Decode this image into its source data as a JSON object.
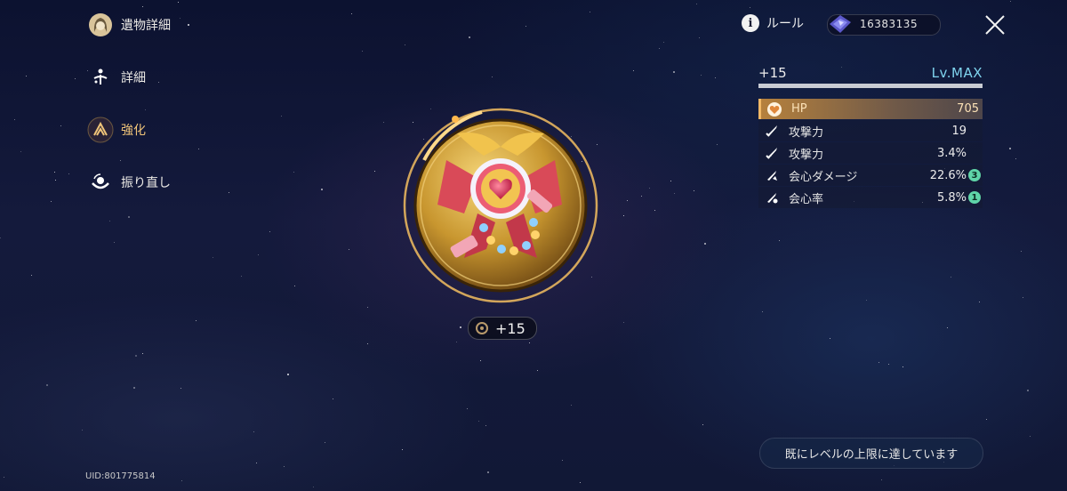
{
  "nav": {
    "items": [
      {
        "label": "遺物詳細",
        "icon": "character-portrait-icon",
        "active": false
      },
      {
        "label": "詳細",
        "icon": "details-icon",
        "active": false
      },
      {
        "label": "強化",
        "icon": "enhance-icon",
        "active": true
      },
      {
        "label": "振り直し",
        "icon": "reroll-icon",
        "active": false
      }
    ]
  },
  "topbar": {
    "rule_label": "ルール",
    "currency_value": "16383135",
    "icons": [
      "info-icon",
      "gem-ticket-icon",
      "close-icon"
    ]
  },
  "stats": {
    "level": "+15",
    "level_label": "Lv.MAX",
    "progress": 1.0,
    "main": {
      "name": "HP",
      "value": "705"
    },
    "subs": [
      {
        "name": "攻撃力",
        "value": "19",
        "badge": null
      },
      {
        "name": "攻撃力",
        "value": "3.4%",
        "badge": null
      },
      {
        "name": "会心ダメージ",
        "value": "22.6%",
        "badge": "3"
      },
      {
        "name": "会心率",
        "value": "5.8%",
        "badge": "1"
      }
    ]
  },
  "relic": {
    "enhance_level": "+15"
  },
  "notice": "既にレベルの上限に達しています",
  "uid": "UID:801775814",
  "colors": {
    "accent_gold": "#f0c479",
    "level_max": "#7fd4ee",
    "badge": "#5fd4a8"
  }
}
